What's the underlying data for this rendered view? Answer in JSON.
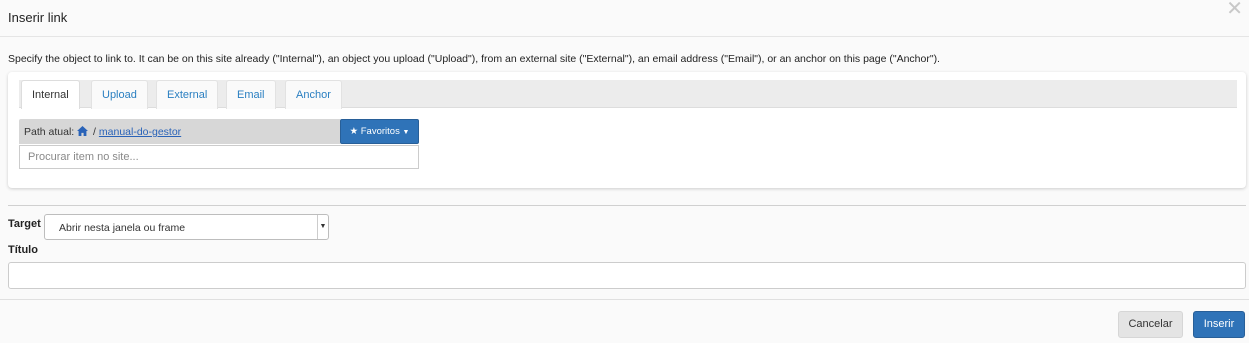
{
  "modal": {
    "title": "Inserir link",
    "close_glyph": "✕",
    "help_text": "Specify the object to link to. It can be on this site already (\"Internal\"), an object you upload (\"Upload\"), from an external site (\"External\"), an email address (\"Email\"), or an anchor on this page (\"Anchor\")."
  },
  "tabs": [
    {
      "label": "Internal",
      "active": true
    },
    {
      "label": "Upload"
    },
    {
      "label": "External"
    },
    {
      "label": "Email"
    },
    {
      "label": "Anchor"
    }
  ],
  "internal": {
    "path_prefix": "Path atual:",
    "path_separator": "/",
    "path_link": "manual-do-gestor",
    "favorites_label": "Favoritos",
    "search_placeholder": "Procurar item no site..."
  },
  "form": {
    "target_label": "Target",
    "target_value": "Abrir nesta janela ou frame",
    "title_label": "Título",
    "title_value": ""
  },
  "footer": {
    "cancel_label": "Cancelar",
    "insert_label": "Inserir"
  },
  "colors": {
    "primary": "#2f73b8",
    "link": "#2a7fc1"
  },
  "icons": [
    "close-icon",
    "home-icon",
    "star-icon",
    "caret-down-icon"
  ]
}
